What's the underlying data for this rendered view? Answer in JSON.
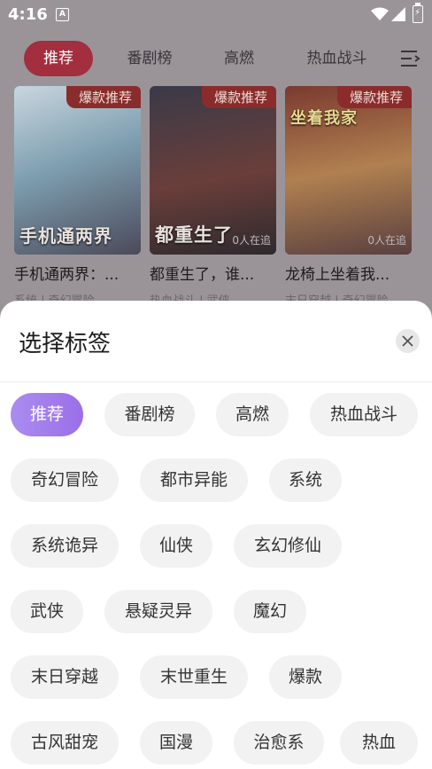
{
  "status_bar": {
    "time": "4:16",
    "app_icon_letter": "A"
  },
  "tabs": [
    {
      "label": "推荐",
      "active": true
    },
    {
      "label": "番剧榜"
    },
    {
      "label": "高燃"
    },
    {
      "label": "热血战斗"
    }
  ],
  "cards": [
    {
      "badge": "爆款推荐",
      "cover_title": "手机通两界",
      "follow": "",
      "name": "手机通两界：...",
      "tags": "系统 | 奇幻冒险"
    },
    {
      "badge": "爆款推荐",
      "cover_title": "都重生了",
      "follow": "0人在追",
      "name": "都重生了，谁...",
      "tags": "热血战斗 | 武侠"
    },
    {
      "badge": "爆款推荐",
      "cover_title": "坐着我家",
      "follow": "0人在追",
      "name": "龙椅上坐着我...",
      "tags": "末日穿越 | 奇幻冒险"
    }
  ],
  "sheet": {
    "title": "选择标签",
    "chips": [
      "推荐",
      "番剧榜",
      "高燃",
      "热血战斗",
      "奇幻冒险",
      "都市异能",
      "系统",
      "系统诡异",
      "仙侠",
      "玄幻修仙",
      "武侠",
      "悬疑灵异",
      "魔幻",
      "末日穿越",
      "末世重生",
      "爆款",
      "古风甜宠",
      "国漫",
      "治愈系",
      "热血"
    ],
    "selected": "推荐"
  },
  "colors": {
    "active_tab": "#a22e3e",
    "chip_selected": "#9c6ee8",
    "badge": "#8a2c2c"
  }
}
